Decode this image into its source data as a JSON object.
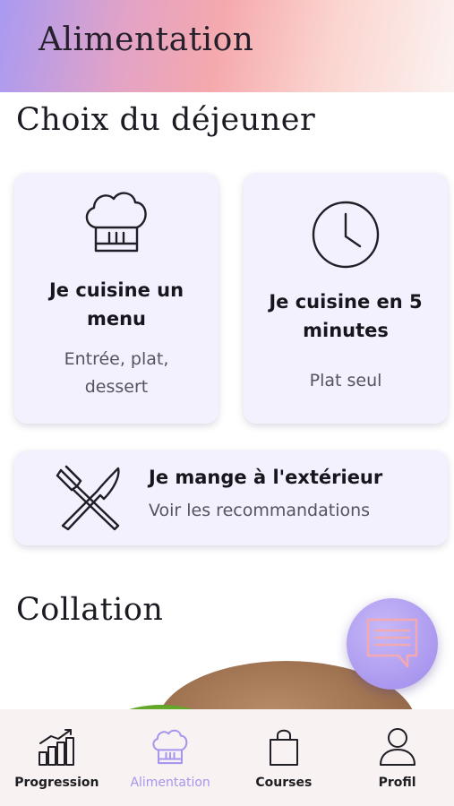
{
  "header": {
    "title": "Alimentation"
  },
  "lunch": {
    "title": "Choix du déjeuner",
    "menu_card": {
      "icon": "chef-hat-icon",
      "title_line1": "Je cuisine un",
      "title_line2": "menu",
      "sub_line1": "Entrée, plat,",
      "sub_line2": "dessert"
    },
    "quick_card": {
      "icon": "clock-icon",
      "title_line1": "Je cuisine en 5",
      "title_line2": "minutes",
      "sub": "Plat seul"
    },
    "outside_card": {
      "icon": "fork-knife-icon",
      "title": "Je mange à l'extérieur",
      "sub": "Voir les recommandations"
    }
  },
  "snack": {
    "title": "Collation"
  },
  "chat": {
    "icon": "chat-bubble-icon"
  },
  "nav": {
    "items": [
      {
        "label": "Progression",
        "icon": "bar-chart-icon",
        "active": false
      },
      {
        "label": "Alimentation",
        "icon": "chef-hat-icon",
        "active": true
      },
      {
        "label": "Courses",
        "icon": "shopping-bag-icon",
        "active": false
      },
      {
        "label": "Profil",
        "icon": "user-icon",
        "active": false
      }
    ]
  },
  "colors": {
    "accent": "#a895ee",
    "card_bg": "#f4f1fe",
    "nav_bg": "#f8f2f2"
  }
}
